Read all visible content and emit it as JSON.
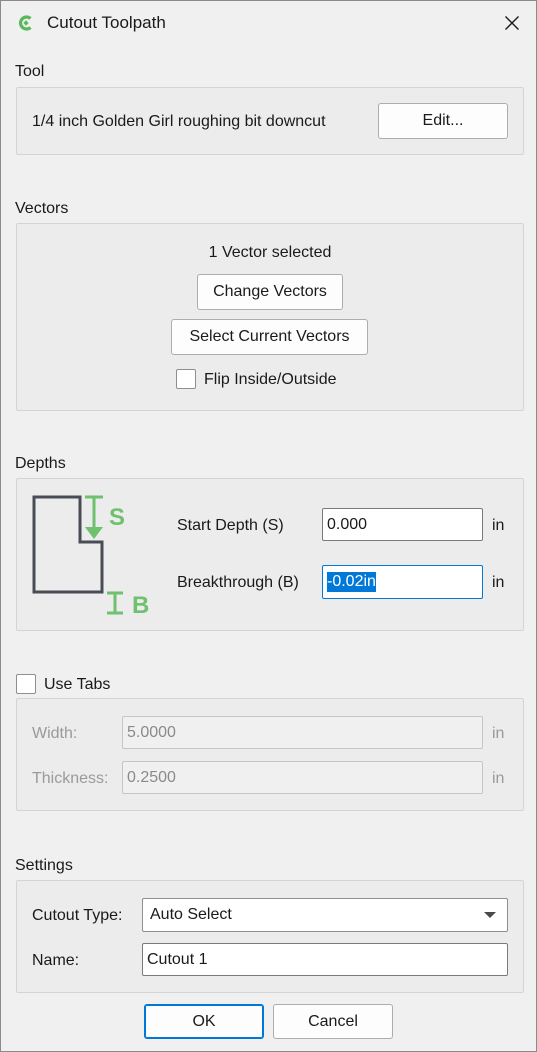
{
  "window": {
    "title": "Cutout Toolpath",
    "brand_color": "#5cb85c"
  },
  "tool": {
    "section_label": "Tool",
    "tool_name": "1/4 inch Golden Girl roughing bit downcut",
    "edit_label": "Edit..."
  },
  "vectors": {
    "section_label": "Vectors",
    "status": "1 Vector selected",
    "change_label": "Change Vectors",
    "select_current_label": "Select Current Vectors",
    "flip_label": "Flip Inside/Outside",
    "flip_checked": false
  },
  "depths": {
    "section_label": "Depths",
    "diagram_s": "S",
    "diagram_b": "B",
    "start_label": "Start Depth (S)",
    "start_value": "0.000",
    "start_unit": "in",
    "breakthrough_label": "Breakthrough (B)",
    "breakthrough_value": "-0.02in",
    "breakthrough_unit": "in",
    "accent_color": "#6fc06f"
  },
  "tabs": {
    "use_tabs_label": "Use Tabs",
    "use_tabs_checked": false,
    "width_label": "Width:",
    "width_value": "5.0000",
    "width_unit": "in",
    "thickness_label": "Thickness:",
    "thickness_value": "0.2500",
    "thickness_unit": "in"
  },
  "settings": {
    "section_label": "Settings",
    "cutout_type_label": "Cutout Type:",
    "cutout_type_value": "Auto Select",
    "name_label": "Name:",
    "name_value": "Cutout 1"
  },
  "buttons": {
    "ok_label": "OK",
    "cancel_label": "Cancel"
  }
}
